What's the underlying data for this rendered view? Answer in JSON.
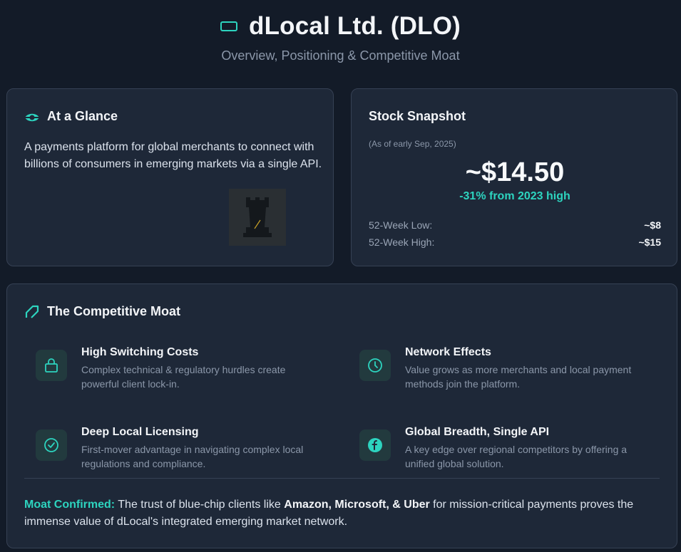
{
  "header": {
    "title": "dLocal Ltd. (DLO)",
    "subtitle": "Overview, Positioning & Competitive Moat"
  },
  "glance": {
    "heading": "At a Glance",
    "text": "A payments platform for global merchants to connect with billions of consumers in emerging markets via a single API."
  },
  "stock": {
    "heading": "Stock Snapshot",
    "date": "(As of early Sep, 2025)",
    "price": "~$14.50",
    "change": "-31% from 2023 high",
    "low_label": "52-Week Low:",
    "low_value": "~$8",
    "high_label": "52-Week High:",
    "high_value": "~$15"
  },
  "moat": {
    "heading": "The Competitive Moat",
    "items": [
      {
        "title": "High Switching Costs",
        "desc": "Complex technical & regulatory hurdles create powerful client lock-in.",
        "icon": "lock-icon"
      },
      {
        "title": "Network Effects",
        "desc": "Value grows as more merchants and local payment methods join the platform.",
        "icon": "clock-icon"
      },
      {
        "title": "Deep Local Licensing",
        "desc": "First-mover advantage in navigating complex local regulations and compliance.",
        "icon": "check-circle-icon"
      },
      {
        "title": "Global Breadth, Single API",
        "desc": "A key edge over regional competitors by offering a unified global solution.",
        "icon": "globe-icon"
      }
    ],
    "confirm_label": "Moat Confirmed:",
    "confirm_pre": " The trust of blue-chip clients like ",
    "confirm_clients": "Amazon, Microsoft, & Uber",
    "confirm_post": " for mission-critical payments proves the immense value of dLocal's integrated emerging market network."
  },
  "colors": {
    "accent": "#2dd4bf",
    "background": "#131b28",
    "card": "#1e2838"
  }
}
